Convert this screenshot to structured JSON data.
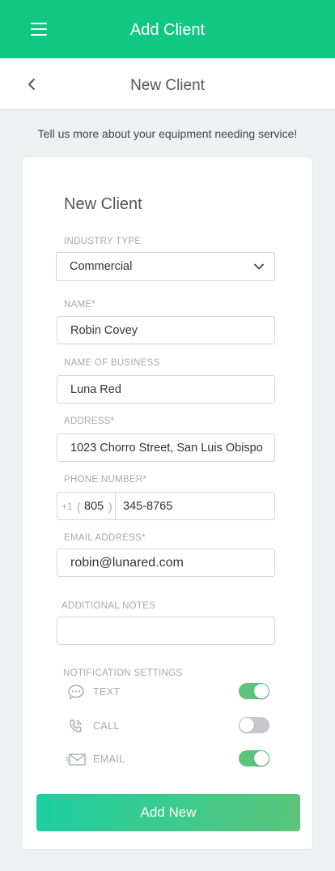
{
  "appbar": {
    "title": "Add Client"
  },
  "subheader": {
    "title": "New Client"
  },
  "tagline": "Tell us more about your equipment needing service!",
  "form": {
    "title": "New Client",
    "industry": {
      "label": "INDUSTRY TYPE",
      "value": "Commercial"
    },
    "name": {
      "label": "NAME*",
      "value": "Robin Covey"
    },
    "business": {
      "label": "NAME OF BUSINESS",
      "value": "Luna Red"
    },
    "address": {
      "label": "ADDRESS*",
      "value": "1023 Chorro Street, San Luis Obispo"
    },
    "phone": {
      "label": "PHONE NUMBER*",
      "country_code": "+1",
      "open_paren": "(",
      "area_code": "805",
      "close_paren": ")",
      "number": "345-8765"
    },
    "email": {
      "label": "EMAIL ADDRESS*",
      "value": "robin@lunared.com"
    },
    "notes": {
      "label": "ADDITIONAL NOTES",
      "value": ""
    },
    "notifications": {
      "label": "NOTIFICATION SETTINGS",
      "text": {
        "label": "TEXT",
        "enabled": true
      },
      "call": {
        "label": "CALL",
        "enabled": false
      },
      "email": {
        "label": "EMAIL",
        "enabled": true
      }
    },
    "submit_label": "Add New"
  },
  "colors": {
    "brand": "#11c784",
    "toggle_on": "#5cc57a",
    "toggle_off": "#c5c8cc"
  }
}
